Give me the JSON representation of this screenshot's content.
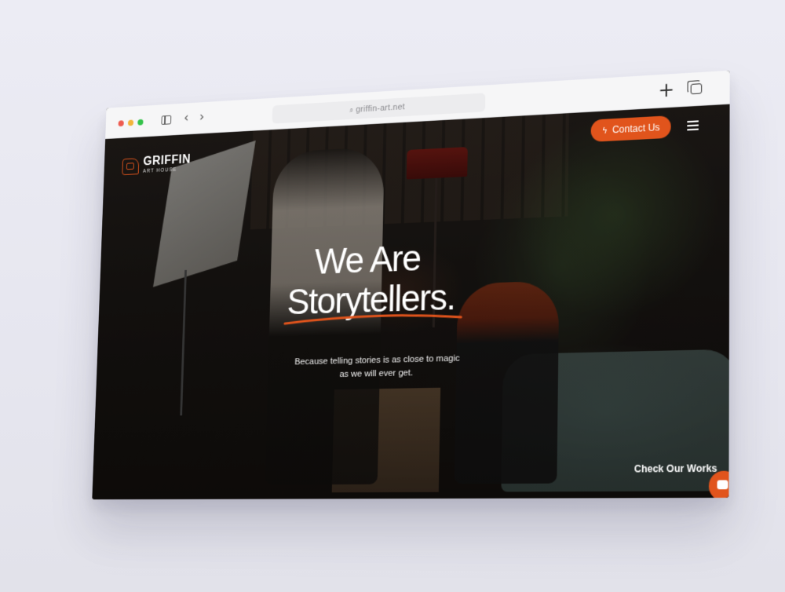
{
  "browser": {
    "url": "griffin-art.net"
  },
  "site": {
    "logo_name": "GRIFFIN",
    "logo_sub": "ART HOUSE",
    "contact_label": "Contact Us"
  },
  "hero": {
    "headline_line1": "We Are",
    "headline_line2": "Storytellers.",
    "subtext_line1": "Because telling stories is as close to magic",
    "subtext_line2": "as we will ever get.",
    "cta": "Check Our Works"
  },
  "colors": {
    "accent": "#e1541c",
    "background": "#e8e8f0"
  }
}
